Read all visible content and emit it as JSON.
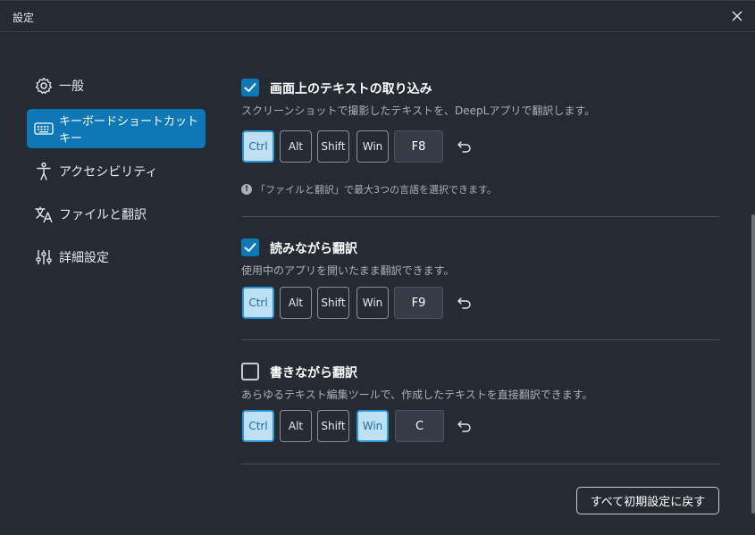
{
  "window": {
    "title": "設定"
  },
  "sidebar": {
    "items": [
      {
        "label": "一般",
        "icon": "gear-icon",
        "active": false
      },
      {
        "label": "キーボードショートカットキー",
        "icon": "keyboard-icon",
        "active": true
      },
      {
        "label": "アクセシビリティ",
        "icon": "accessibility-icon",
        "active": false
      },
      {
        "label": "ファイルと翻訳",
        "icon": "translate-icon",
        "active": false
      },
      {
        "label": "詳細設定",
        "icon": "sliders-icon",
        "active": false
      }
    ]
  },
  "sections": [
    {
      "title": "画面上のテキストの取り込み",
      "description": "スクリーンショットで撮影したテキストを、DeepLアプリで翻訳します。",
      "checked": true,
      "modifiers": [
        {
          "label": "Ctrl",
          "on": true
        },
        {
          "label": "Alt",
          "on": false
        },
        {
          "label": "Shift",
          "on": false
        },
        {
          "label": "Win",
          "on": false
        }
      ],
      "key": "F8"
    },
    {
      "title": "読みながら翻訳",
      "description": "使用中のアプリを開いたまま翻訳できます。",
      "checked": true,
      "modifiers": [
        {
          "label": "Ctrl",
          "on": true
        },
        {
          "label": "Alt",
          "on": false
        },
        {
          "label": "Shift",
          "on": false
        },
        {
          "label": "Win",
          "on": false
        }
      ],
      "key": "F9"
    },
    {
      "title": "書きながら翻訳",
      "description": "あらゆるテキスト編集ツールで、作成したテキストを直接翻訳できます。",
      "checked": false,
      "modifiers": [
        {
          "label": "Ctrl",
          "on": true
        },
        {
          "label": "Alt",
          "on": false
        },
        {
          "label": "Shift",
          "on": false
        },
        {
          "label": "Win",
          "on": true
        }
      ],
      "key": "C"
    }
  ],
  "info_note": "「ファイルと翻訳」で最大3つの言語を選択できます。",
  "reset_all_label": "すべて初期設定に戻す",
  "colors": {
    "accent": "#0e78b7",
    "background": "#252a33",
    "key_active_bg": "#bfe0f3"
  }
}
